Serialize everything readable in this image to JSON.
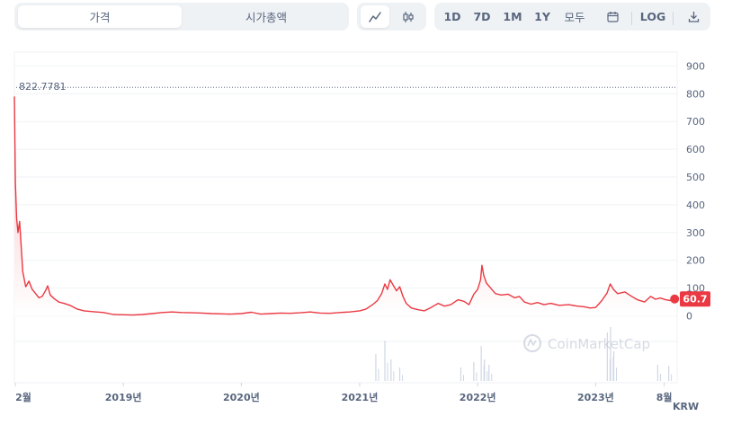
{
  "toolbar": {
    "tabs": [
      {
        "label": "가격",
        "active": true
      },
      {
        "label": "시가총액",
        "active": false
      }
    ],
    "chart_type_icons": [
      "line-chart-icon",
      "candlestick-icon"
    ],
    "ranges": [
      "1D",
      "7D",
      "1M",
      "1Y",
      "모두"
    ],
    "calendar_icon": "calendar-icon",
    "log_label": "LOG",
    "download_icon": "download-icon"
  },
  "watermark": "CoinMarketCap",
  "currency": "KRW",
  "colors": {
    "line": "#ea3943",
    "fill_top": "#f6bcbf",
    "fill_bottom": "#ffffff",
    "badge": "#ea3943",
    "grid": "#eff2f5",
    "volume": "#cfd6e4",
    "text": "#58667e"
  },
  "chart_data": {
    "type": "area",
    "title": "",
    "xlabel": "",
    "ylabel": "",
    "ylim": [
      -50,
      930
    ],
    "yticks": [
      0,
      100,
      200,
      300,
      400,
      500,
      600,
      700,
      800,
      900
    ],
    "ytick_labels": [
      "0",
      "100",
      "200",
      "300",
      "400",
      "500",
      "600",
      "700",
      "800",
      "900"
    ],
    "xlim": [
      "2018-01-29",
      "2023-09-10"
    ],
    "xticks": [
      {
        "date": "2018-02-01",
        "label": "2월"
      },
      {
        "date": "2019-01-01",
        "label": "2019년"
      },
      {
        "date": "2020-01-01",
        "label": "2020년"
      },
      {
        "date": "2021-01-01",
        "label": "2021년"
      },
      {
        "date": "2022-01-01",
        "label": "2022년"
      },
      {
        "date": "2023-01-01",
        "label": "2023년"
      },
      {
        "date": "2023-08-01",
        "label": "8월"
      }
    ],
    "max_label": "822.7781",
    "max_value": 822.7781,
    "current_label": "60.7",
    "current_value": 60.7,
    "grid": true,
    "series": [
      {
        "values": [
          [
            "2018-01-29",
            790
          ],
          [
            "2018-02-01",
            480
          ],
          [
            "2018-02-05",
            350
          ],
          [
            "2018-02-09",
            300
          ],
          [
            "2018-02-14",
            340
          ],
          [
            "2018-02-18",
            270
          ],
          [
            "2018-02-24",
            160
          ],
          [
            "2018-03-05",
            105
          ],
          [
            "2018-03-15",
            125
          ],
          [
            "2018-03-25",
            95
          ],
          [
            "2018-04-05",
            80
          ],
          [
            "2018-04-15",
            65
          ],
          [
            "2018-04-25",
            70
          ],
          [
            "2018-05-05",
            90
          ],
          [
            "2018-05-12",
            108
          ],
          [
            "2018-05-20",
            75
          ],
          [
            "2018-06-01",
            62
          ],
          [
            "2018-06-15",
            50
          ],
          [
            "2018-07-01",
            45
          ],
          [
            "2018-07-20",
            38
          ],
          [
            "2018-08-10",
            25
          ],
          [
            "2018-09-01",
            18
          ],
          [
            "2018-10-01",
            15
          ],
          [
            "2018-11-01",
            12
          ],
          [
            "2018-12-01",
            5
          ],
          [
            "2019-01-01",
            4
          ],
          [
            "2019-02-01",
            3
          ],
          [
            "2019-03-01",
            5
          ],
          [
            "2019-04-01",
            8
          ],
          [
            "2019-05-01",
            12
          ],
          [
            "2019-06-01",
            14
          ],
          [
            "2019-07-01",
            12
          ],
          [
            "2019-08-01",
            11
          ],
          [
            "2019-09-01",
            10
          ],
          [
            "2019-10-01",
            8
          ],
          [
            "2019-11-01",
            7
          ],
          [
            "2019-12-01",
            6
          ],
          [
            "2020-01-01",
            8
          ],
          [
            "2020-02-01",
            13
          ],
          [
            "2020-03-01",
            6
          ],
          [
            "2020-04-01",
            8
          ],
          [
            "2020-05-01",
            10
          ],
          [
            "2020-06-01",
            9
          ],
          [
            "2020-07-01",
            11
          ],
          [
            "2020-08-01",
            14
          ],
          [
            "2020-09-01",
            10
          ],
          [
            "2020-10-01",
            9
          ],
          [
            "2020-11-01",
            12
          ],
          [
            "2020-12-01",
            14
          ],
          [
            "2021-01-01",
            18
          ],
          [
            "2021-01-20",
            24
          ],
          [
            "2021-02-10",
            40
          ],
          [
            "2021-02-25",
            55
          ],
          [
            "2021-03-10",
            80
          ],
          [
            "2021-03-20",
            115
          ],
          [
            "2021-03-28",
            95
          ],
          [
            "2021-04-05",
            130
          ],
          [
            "2021-04-15",
            110
          ],
          [
            "2021-04-25",
            90
          ],
          [
            "2021-05-05",
            105
          ],
          [
            "2021-05-15",
            70
          ],
          [
            "2021-05-25",
            45
          ],
          [
            "2021-06-10",
            28
          ],
          [
            "2021-07-01",
            22
          ],
          [
            "2021-07-20",
            18
          ],
          [
            "2021-08-10",
            30
          ],
          [
            "2021-09-01",
            45
          ],
          [
            "2021-09-20",
            35
          ],
          [
            "2021-10-10",
            40
          ],
          [
            "2021-11-01",
            58
          ],
          [
            "2021-11-20",
            52
          ],
          [
            "2021-12-05",
            40
          ],
          [
            "2021-12-20",
            78
          ],
          [
            "2022-01-01",
            95
          ],
          [
            "2022-01-10",
            130
          ],
          [
            "2022-01-14",
            182
          ],
          [
            "2022-01-20",
            145
          ],
          [
            "2022-01-28",
            118
          ],
          [
            "2022-02-10",
            100
          ],
          [
            "2022-02-25",
            80
          ],
          [
            "2022-03-15",
            75
          ],
          [
            "2022-04-05",
            78
          ],
          [
            "2022-04-25",
            65
          ],
          [
            "2022-05-10",
            70
          ],
          [
            "2022-05-25",
            50
          ],
          [
            "2022-06-15",
            42
          ],
          [
            "2022-07-05",
            48
          ],
          [
            "2022-07-25",
            40
          ],
          [
            "2022-08-15",
            45
          ],
          [
            "2022-09-10",
            38
          ],
          [
            "2022-10-10",
            40
          ],
          [
            "2022-11-05",
            35
          ],
          [
            "2022-11-25",
            33
          ],
          [
            "2022-12-15",
            28
          ],
          [
            "2023-01-01",
            30
          ],
          [
            "2023-01-20",
            55
          ],
          [
            "2023-02-05",
            82
          ],
          [
            "2023-02-15",
            115
          ],
          [
            "2023-02-25",
            95
          ],
          [
            "2023-03-10",
            80
          ],
          [
            "2023-04-01",
            86
          ],
          [
            "2023-04-20",
            72
          ],
          [
            "2023-05-10",
            58
          ],
          [
            "2023-06-01",
            50
          ],
          [
            "2023-06-20",
            70
          ],
          [
            "2023-07-05",
            60
          ],
          [
            "2023-07-20",
            64
          ],
          [
            "2023-08-05",
            58
          ],
          [
            "2023-08-20",
            55
          ],
          [
            "2023-09-05",
            60.7
          ]
        ]
      }
    ],
    "volume": {
      "spikes": [
        {
          "date": "2021-02-20",
          "level": 0.5
        },
        {
          "date": "2021-03-20",
          "level": 0.75
        },
        {
          "date": "2021-04-08",
          "level": 0.4
        },
        {
          "date": "2021-05-05",
          "level": 0.25
        },
        {
          "date": "2021-11-10",
          "level": 0.25
        },
        {
          "date": "2021-12-20",
          "level": 0.35
        },
        {
          "date": "2022-01-12",
          "level": 0.65
        },
        {
          "date": "2022-01-22",
          "level": 0.4
        },
        {
          "date": "2022-02-05",
          "level": 0.3
        },
        {
          "date": "2023-02-06",
          "level": 0.9
        },
        {
          "date": "2023-02-16",
          "level": 1.0
        },
        {
          "date": "2023-02-26",
          "level": 0.55
        },
        {
          "date": "2023-07-12",
          "level": 0.3
        },
        {
          "date": "2023-08-15",
          "level": 0.28
        }
      ]
    }
  }
}
